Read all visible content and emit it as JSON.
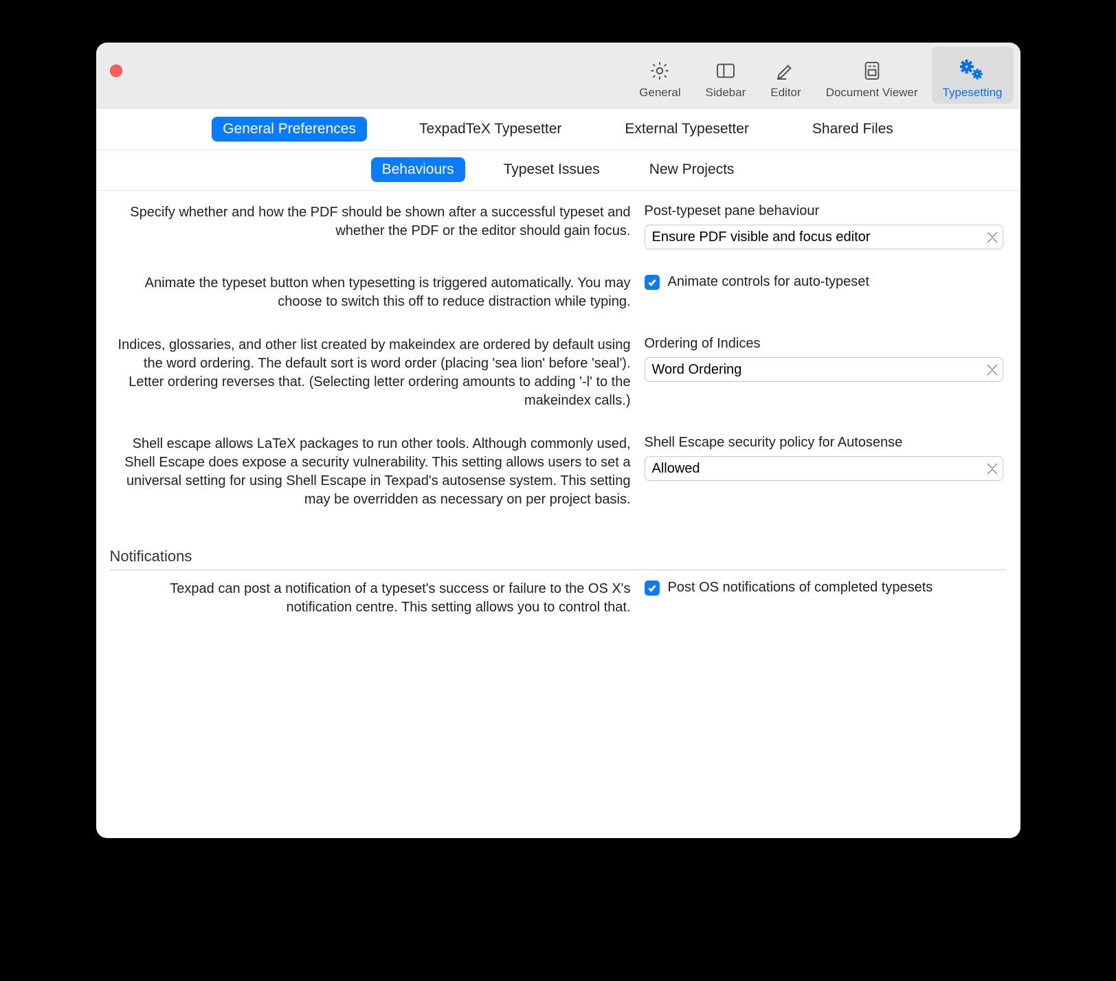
{
  "toolbar": {
    "tabs": [
      {
        "label": "General"
      },
      {
        "label": "Sidebar"
      },
      {
        "label": "Editor"
      },
      {
        "label": "Document Viewer"
      },
      {
        "label": "Typesetting"
      }
    ]
  },
  "subtabs1": [
    "General Preferences",
    "TexpadTeX Typesetter",
    "External Typesetter",
    "Shared Files"
  ],
  "subtabs2": [
    "Behaviours",
    "Typeset Issues",
    "New Projects"
  ],
  "rows": {
    "pdf": {
      "desc": "Specify whether and how the PDF should be shown after a successful typeset and whether the PDF or the editor should gain focus.",
      "label": "Post-typeset pane behaviour",
      "value": "Ensure PDF visible and focus editor"
    },
    "animate": {
      "desc": "Animate the typeset button when typesetting is triggered automatically. You may choose to switch this off to reduce distraction while typing.",
      "label": "Animate controls for auto-typeset"
    },
    "indices": {
      "desc": "Indices, glossaries, and other list created by makeindex are ordered by default using the word ordering. The default sort is word order (placing 'sea lion' before 'seal'). Letter ordering reverses that. (Selecting letter ordering amounts to adding '-l' to the makeindex calls.)",
      "label": "Ordering of Indices",
      "value": "Word Ordering"
    },
    "shell": {
      "desc": "Shell escape allows LaTeX packages to run other tools. Although commonly used, Shell Escape does expose a security vulnerability. This setting allows users to set a universal setting for using Shell Escape in Texpad's autosense system. This setting may be overridden as necessary on per project basis.",
      "label": "Shell Escape security policy for Autosense",
      "value": "Allowed"
    }
  },
  "notifications": {
    "header": "Notifications",
    "desc": "Texpad can post a notification of a typeset's success or failure to the OS X's notification centre. This setting allows you to control that.",
    "label": "Post OS notifications of completed typesets"
  }
}
